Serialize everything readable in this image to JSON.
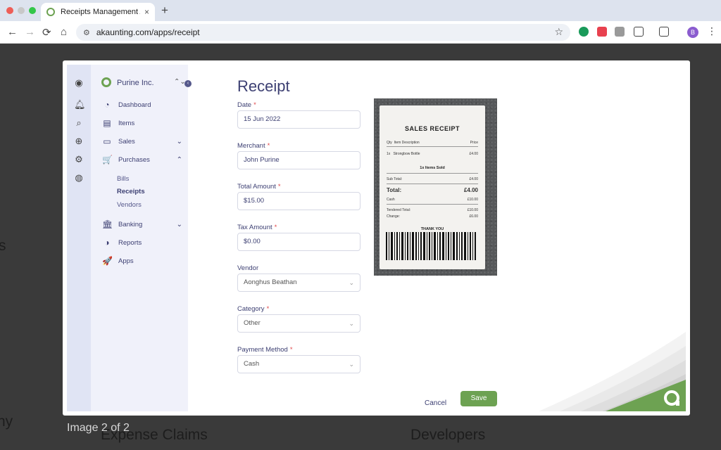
{
  "browser": {
    "tab_title": "Receipts Management App -",
    "tab_close": "×",
    "new_tab": "+",
    "url": "akaunting.com/apps/receipt",
    "back": "←",
    "forward": "→",
    "reload": "⟳",
    "home": "⌂",
    "site_info": "⚙",
    "star": "☆",
    "profile_initial": "B",
    "menu": "⋮"
  },
  "background": {
    "left_text_1": "s",
    "left_text_2": "ny",
    "col1": "Expense Claims",
    "col2": "Developers",
    "image_counter": "Image 2 of 2"
  },
  "iconbar": {
    "icons": [
      "profile-icon",
      "bell-icon",
      "search-icon",
      "plus-circle-icon",
      "gear-icon",
      "globe-icon"
    ]
  },
  "sidebar": {
    "company": "Purine Inc.",
    "switch": "⌃⌄",
    "collapse": "‹",
    "items": [
      {
        "label": "Dashboard",
        "icon": "◔"
      },
      {
        "label": "Items",
        "icon": "▤"
      },
      {
        "label": "Sales",
        "icon": "▭",
        "chevron": "⌄"
      },
      {
        "label": "Purchases",
        "icon": "🛒",
        "chevron": "⌃"
      },
      {
        "label": "Banking",
        "icon": "🏛",
        "chevron": "⌄"
      },
      {
        "label": "Reports",
        "icon": "◑"
      },
      {
        "label": "Apps",
        "icon": "🚀"
      }
    ],
    "sub_items": [
      {
        "label": "Bills"
      },
      {
        "label": "Receipts"
      },
      {
        "label": "Vendors"
      }
    ]
  },
  "form": {
    "title": "Receipt",
    "required_mark": "*",
    "date_label": "Date",
    "date_value": "15 Jun 2022",
    "merchant_label": "Merchant",
    "merchant_value": "John Purine",
    "total_label": "Total Amount",
    "total_value": "$15.00",
    "tax_label": "Tax Amount",
    "tax_value": "$0.00",
    "vendor_label": "Vendor",
    "vendor_value": "Aonghus Beathan",
    "category_label": "Category",
    "category_value": "Other",
    "payment_label": "Payment Method",
    "payment_value": "Cash",
    "cancel": "Cancel",
    "save": "Save"
  },
  "receipt": {
    "title": "SALES RECEIPT",
    "col_qty": "Qty",
    "col_desc": "Item Description",
    "col_price": "Price",
    "item_qty": "1x",
    "item_desc": "Strongbow Bottle",
    "item_price": "£4.00",
    "items_sold": "1x Items Sold",
    "subtotal_label": "Sub Total:",
    "subtotal_value": "£4.00",
    "total_label": "Total:",
    "total_value": "£4.00",
    "cash_label": "Cash",
    "cash_value": "£10.00",
    "tendered_label": "Tendered Total:",
    "tendered_value": "£10.00",
    "change_label": "Change:",
    "change_value": "£6.00",
    "thanks": "THANK YOU"
  },
  "colors": {
    "brand_green": "#6da252",
    "brand_navy": "#3c3f72",
    "required_red": "#e0484a"
  }
}
